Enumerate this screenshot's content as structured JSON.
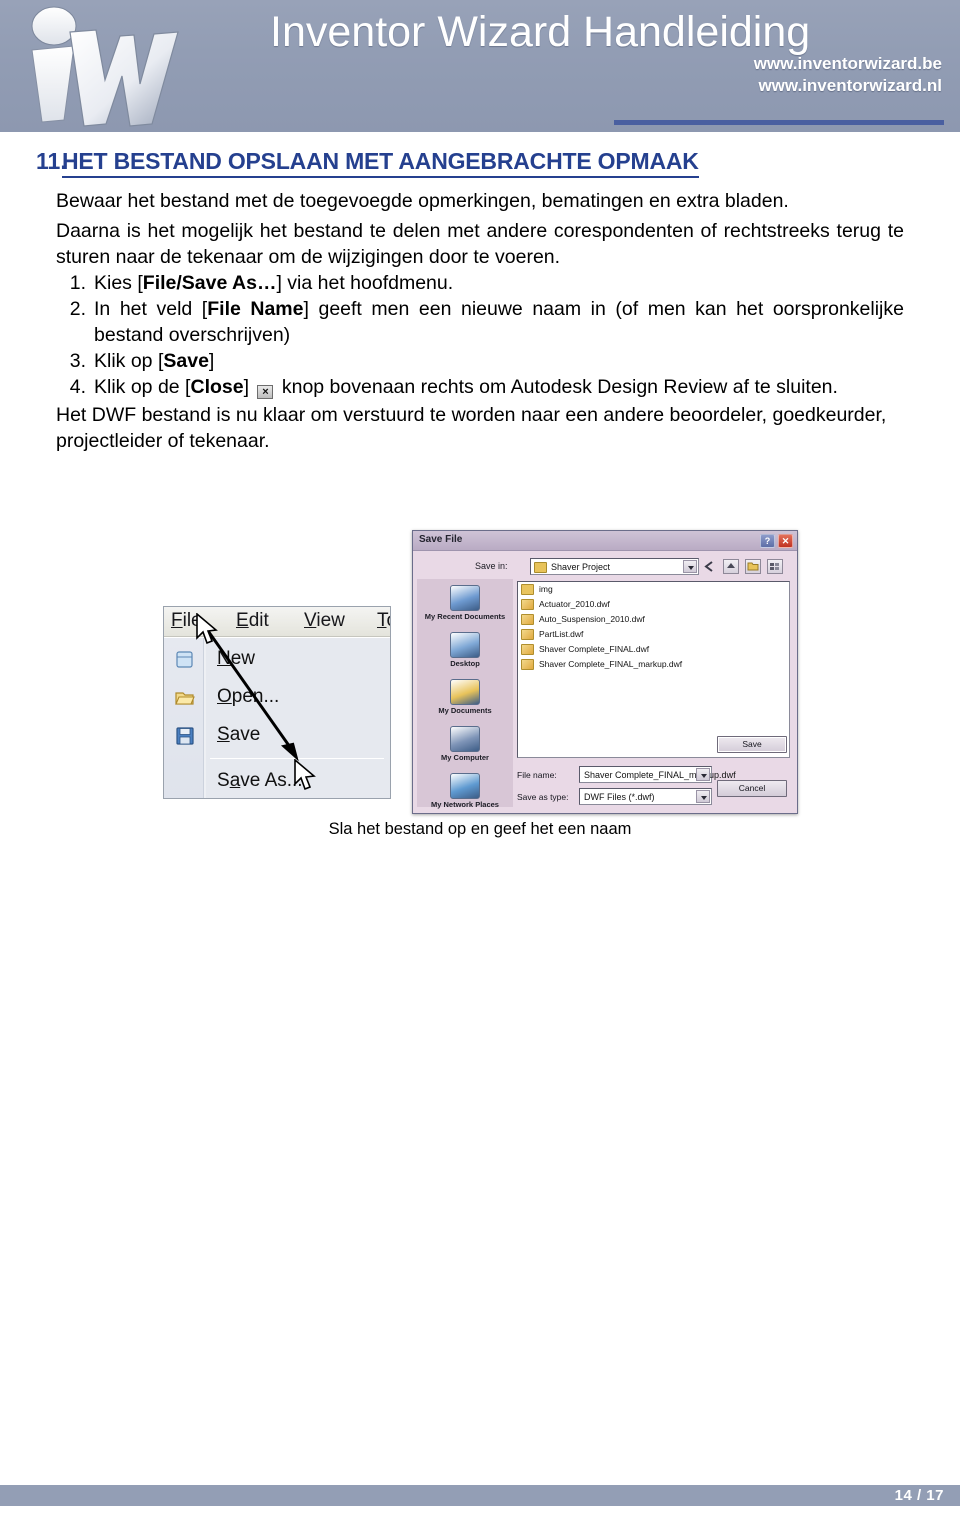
{
  "header": {
    "title": "Inventor Wizard Handleiding",
    "logo_alt": "iW",
    "url_be": "www.inventorwizard.be",
    "url_nl": "www.inventorwizard.nl",
    "accent_color": "#4a5fa0",
    "banner_color": "#929db4"
  },
  "section": {
    "number": "11.",
    "heading": "HET BESTAND OPSLAAN MET AANGEBRACHTE OPMAAK",
    "heading_color": "#25408f",
    "intro_1": "Bewaar het bestand met de toegevoegde opmerkingen, bematingen en extra bladen.",
    "intro_2": "Daarna is het mogelijk het bestand te delen met andere corespondenten of rechtstreeks terug te sturen naar de tekenaar om de wijzigingen door te voeren.",
    "steps": [
      {
        "num": "1.",
        "parts": [
          {
            "t": "Kies [",
            "b": false
          },
          {
            "t": "File/Save As…",
            "b": true
          },
          {
            "t": "] via het hoofdmenu.",
            "b": false
          }
        ]
      },
      {
        "num": "2.",
        "parts": [
          {
            "t": "In het veld [",
            "b": false
          },
          {
            "t": "File Name",
            "b": true
          },
          {
            "t": "] geeft men een nieuwe naam in (of men kan het oorspronkelijke bestand overschrijven)",
            "b": false
          }
        ]
      },
      {
        "num": "3.",
        "parts": [
          {
            "t": "Klik op [",
            "b": false
          },
          {
            "t": "Save",
            "b": true
          },
          {
            "t": "]",
            "b": false
          }
        ]
      },
      {
        "num": "4.",
        "parts": [
          {
            "t": "Klik op de [",
            "b": false
          },
          {
            "t": "Close",
            "b": true
          },
          {
            "t": "] ",
            "b": false
          },
          {
            "icon": "close-button-icon",
            "glyph": "×"
          },
          {
            "t": " knop bovenaan rechts om Autodesk Design Review af te sluiten.",
            "b": false
          }
        ]
      }
    ],
    "outro": "Het DWF bestand is nu klaar om verstuurd te worden naar een andere beoordeler, goedkeurder, projectleider of tekenaar."
  },
  "figure": {
    "caption": "Sla het bestand op en geef het een naam",
    "menu_shot": {
      "menubar": [
        {
          "label": "File",
          "accel": "F"
        },
        {
          "label": "Edit",
          "accel": "E"
        },
        {
          "label": "View",
          "accel": "V"
        },
        {
          "label": "Tools",
          "accel": "T"
        }
      ],
      "dropdown_items": [
        {
          "label": "New",
          "accel": "N",
          "icon": "new-document-icon"
        },
        {
          "label": "Open...",
          "accel": "O",
          "icon": "open-folder-icon"
        },
        {
          "label": "Save",
          "accel": "S",
          "icon": "floppy-disk-icon"
        },
        {
          "label": "Save As...",
          "accel": "a",
          "icon": "none"
        }
      ],
      "annotation": "arrow-pointing-to-save-as"
    },
    "dialog": {
      "title": "Save File",
      "help_btn": "?",
      "close_btn": "✕",
      "save_in_label": "Save in:",
      "save_in_value": "Shaver Project",
      "toolbar_icons": [
        "back-icon",
        "up-one-level-icon",
        "new-folder-icon",
        "views-icon"
      ],
      "files": [
        {
          "name": "img",
          "type": "folder"
        },
        {
          "name": "Actuator_2010.dwf",
          "type": "file"
        },
        {
          "name": "Auto_Suspension_2010.dwf",
          "type": "file"
        },
        {
          "name": "PartList.dwf",
          "type": "file"
        },
        {
          "name": "Shaver Complete_FINAL.dwf",
          "type": "file"
        },
        {
          "name": "Shaver Complete_FINAL_markup.dwf",
          "type": "file"
        }
      ],
      "places": [
        {
          "label": "My Recent Documents",
          "icon": "recent-documents-icon"
        },
        {
          "label": "Desktop",
          "icon": "desktop-icon"
        },
        {
          "label": "My Documents",
          "icon": "my-documents-icon"
        },
        {
          "label": "My Computer",
          "icon": "my-computer-icon"
        },
        {
          "label": "My Network Places",
          "icon": "network-places-icon"
        }
      ],
      "file_name_label": "File name:",
      "file_name_value": "Shaver Complete_FINAL_markup.dwf",
      "save_type_label": "Save as type:",
      "save_type_value": "DWF Files (*.dwf)",
      "save_button": "Save",
      "cancel_button": "Cancel"
    }
  },
  "footer": {
    "page": "14 / 17",
    "bar_color": "#939eb5"
  }
}
